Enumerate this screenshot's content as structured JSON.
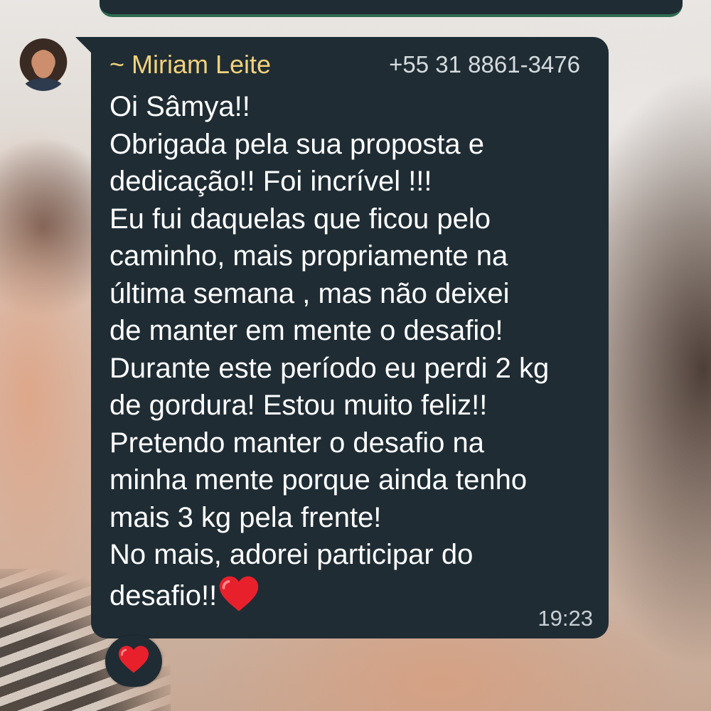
{
  "chat": {
    "sender_name": "~ Miriam Leite",
    "sender_phone": "+55 31 8861-3476",
    "message_lines": [
      "Oi Sâmya!!",
      "Obrigada pela sua proposta e",
      "dedicação!! Foi incrível !!!",
      "Eu fui daquelas que ficou pelo",
      "caminho, mais propriamente na",
      "última semana , mas não deixei",
      "de manter em mente o desafio!",
      "Durante este período eu perdi 2 kg",
      "de gordura! Estou muito feliz!!",
      "Pretendo manter o desafio na",
      "minha mente porque ainda tenho",
      "mais 3 kg pela frente!",
      "No mais, adorei participar do",
      "desafio!!"
    ],
    "time": "19:23",
    "inline_emoji": "red-heart-icon",
    "reaction_emoji": "red-heart-icon"
  },
  "colors": {
    "bubble": "#1f2c34",
    "sender_name": "#f2d27a",
    "text": "#ffffff",
    "heart": "#e8202c"
  }
}
